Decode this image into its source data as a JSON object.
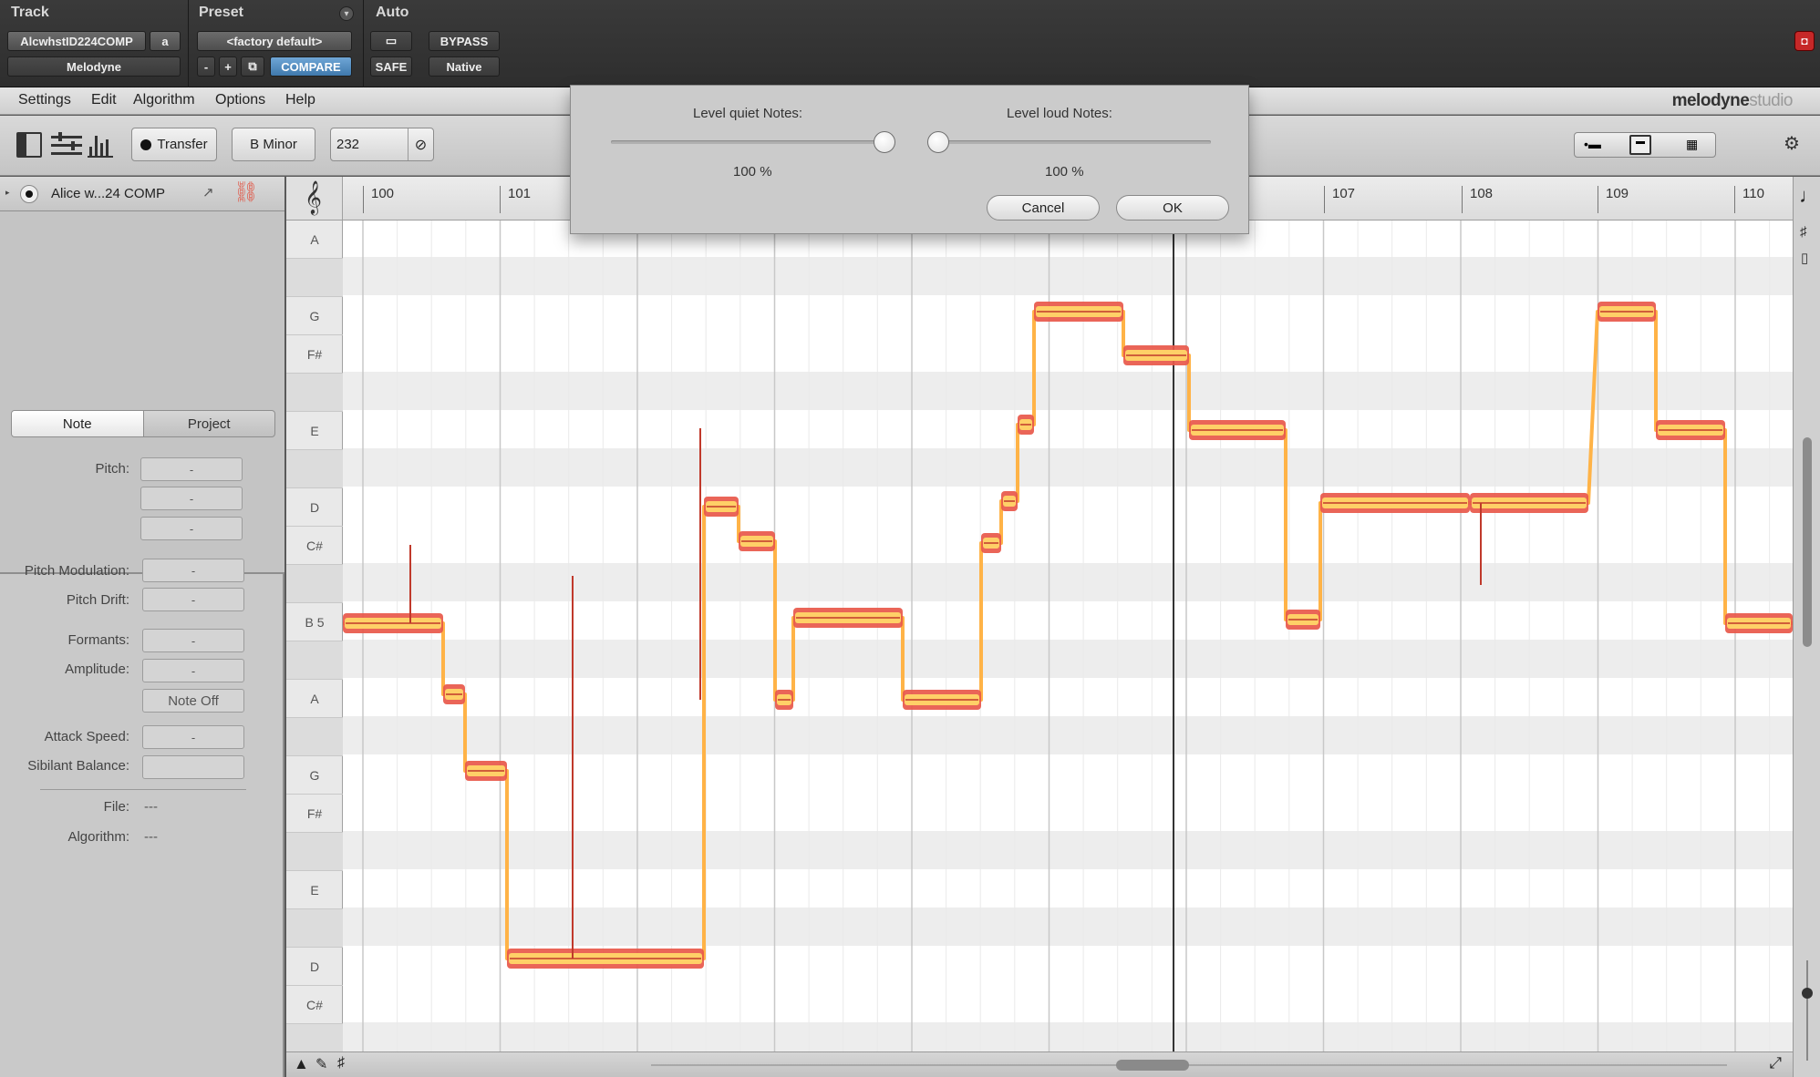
{
  "host": {
    "track_label": "Track",
    "preset_label": "Preset",
    "auto_label": "Auto",
    "track_name": "AlcwhstID224COMP",
    "track_select": "a",
    "plugin_name": "Melodyne",
    "preset_value": "<factory default>",
    "minus": "-",
    "plus": "+",
    "compare": "COMPARE",
    "bypass": "BYPASS",
    "safe": "SAFE",
    "native": "Native"
  },
  "menu": {
    "items": [
      "Settings",
      "Edit",
      "Algorithm",
      "Options",
      "Help"
    ],
    "logo_main": "melodyne",
    "logo_sub": "studio"
  },
  "toolbar": {
    "transfer": "Transfer",
    "scale": "B Minor",
    "tempo": "232"
  },
  "track": {
    "name": "Alice w...24 COMP"
  },
  "inspector": {
    "tab_note": "Note",
    "tab_project": "Project",
    "pitch_label": "Pitch:",
    "pitch_mod_label": "Pitch Modulation:",
    "pitch_drift_label": "Pitch Drift:",
    "formants_label": "Formants:",
    "amplitude_label": "Amplitude:",
    "note_off": "Note Off",
    "attack_label": "Attack Speed:",
    "sibilant_label": "Sibilant Balance:",
    "file_label": "File:",
    "file_value": "---",
    "algorithm_label": "Algorithm:",
    "algorithm_value": "---",
    "dash": "-"
  },
  "keys": [
    "A",
    "",
    "G",
    "F#",
    "",
    "E",
    "",
    "D",
    "C#",
    "",
    "B 5",
    "",
    "A",
    "",
    "G",
    "F#",
    "",
    "E",
    "",
    "D",
    "C#",
    ""
  ],
  "ruler": {
    "bars": [
      "100",
      "101",
      "107",
      "108",
      "109",
      "110"
    ]
  },
  "dialog": {
    "quiet_label": "Level quiet Notes:",
    "quiet_value": "100 %",
    "quiet_level": 1.0,
    "loud_label": "Level loud Notes:",
    "loud_value": "100 %",
    "loud_level": 0.0,
    "cancel": "Cancel",
    "ok": "OK"
  },
  "colors": {
    "blob_outer": "#e8584a",
    "blob_inner": "#ffd067",
    "pitch_line": "#c0392b"
  }
}
